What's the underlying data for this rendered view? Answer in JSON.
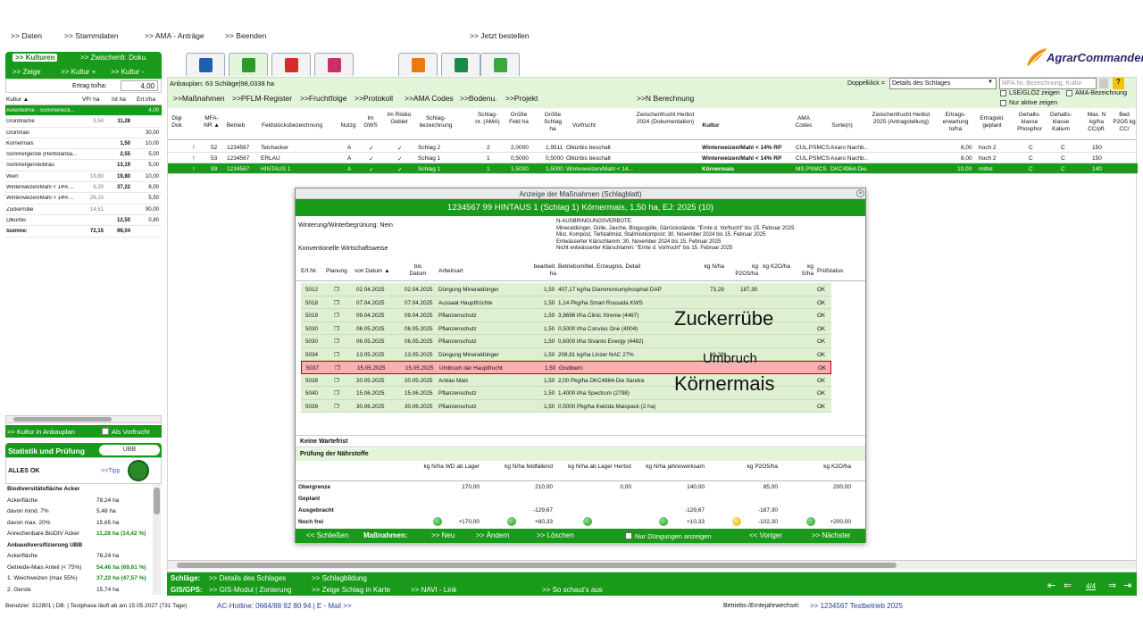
{
  "topmenu": {
    "daten": ">> Daten",
    "stammdaten": ">> Stammdaten",
    "ama": ">> AMA - Anträge",
    "beenden": ">> Beenden",
    "bestellen": ">> Jetzt bestellen"
  },
  "logo": {
    "text": "AgrarCommander"
  },
  "left": {
    "tab1": ">> Kulturen",
    "tab2": ">> Zwischenfr. Doku.",
    "zeige": ">> Zeige",
    "kultur_plus": ">> Kultur +",
    "kultur_minus": ">> Kultur -",
    "ertrag_label": "Ertrag to/ha:",
    "ertrag_value": "4,00",
    "cols": [
      "Kultur ▲",
      "VFr ha",
      "Ist ha",
      "Ert.t/ha"
    ],
    "rows": [
      [
        "Ackerbohne - Sommerwick...",
        "",
        "",
        "4,00"
      ],
      [
        "Grünbrache",
        "5,54",
        "11,28",
        ""
      ],
      [
        "Grünmais",
        "",
        "",
        "30,00"
      ],
      [
        "Körnermais",
        "",
        "1,50",
        "10,00"
      ],
      [
        "Sommergerste (Herbstanba...",
        "",
        "2,55",
        "5,00"
      ],
      [
        "Sommergerste/Brau",
        "",
        "13,19",
        "5,00"
      ],
      [
        "Wein",
        "19,80",
        "19,80",
        "10,00"
      ],
      [
        "Winterweizen/Mahl < 14% ...",
        "6,20",
        "37,22",
        "8,00"
      ],
      [
        "Winterweizen/Mahl > 14% ...",
        "26,10",
        "",
        "5,50"
      ],
      [
        "Zuckerrübe",
        "14,51",
        "",
        "90,00"
      ],
      [
        "Ölkürbis",
        "",
        "12,50",
        "0,80"
      ],
      [
        "Summe:",
        "72,15",
        "98,04",
        ""
      ]
    ],
    "kultur_anbauplan": ">> Kultur in Anbauplan",
    "als_vorfrucht": "Als Vorfrucht",
    "stat_title": "Statistik und Prüfung",
    "ubb": "UBB",
    "alles_ok": "ALLES OK",
    "tipp": ">>Tipp",
    "stat": [
      [
        "Biodiversitätsfläche Acker",
        ""
      ],
      [
        "Ackerfläche",
        "78,24 ha"
      ],
      [
        "davon mind. 7%",
        "5,48 ha"
      ],
      [
        "davon max. 20%",
        "15,65 ha"
      ],
      [
        "Anrechenbare BioDIV Acker",
        "11,28 ha (14,42 %)"
      ],
      [
        "Anbaudiversifizierung UBB",
        ""
      ],
      [
        "Ackerfläche",
        "78,24 ha"
      ],
      [
        "Getreide-Mais Anteil (< 75%)",
        "54,46 ha (69,61 %)"
      ],
      [
        "1. Weichweizen (max 55%)",
        "37,22 ha (47,57 %)"
      ],
      [
        "2. Gerste",
        "15,74 ha"
      ]
    ]
  },
  "main": {
    "anbauplan": "Anbauplan: 63 Schläge|98,0338 ha",
    "doppelklick": "Doppelklick =",
    "select_value": "Details des Schlages",
    "search_placeholder": "MFA.Nr, Bezeichnung, Kultur",
    "lse": "LSE/GLÖZ zeigen",
    "ama_bez": "AMA-Bezeichnung",
    "nur_aktive": "Nur aktive zeigen",
    "links": [
      ">>Maßnahmen",
      ">>PFLM-Register",
      ">>Fruchtfolge",
      ">>Protokoll",
      ">>AMA Codes",
      ">>Bodenu.",
      ">>Projekt",
      ">>N Berechnung"
    ],
    "headers": [
      "Digi Dok",
      "MFA-NR ▲",
      "Betrieb",
      "Feldstücksbezeichnung",
      "Nutzg",
      "Im GWS",
      "Im Risiko Gebiet",
      "Schlag-bezeichnung",
      "Schlag-nr. (AMA)",
      "Größe Feld ha",
      "Größe Schlag ha",
      "Vorfrucht",
      "Zwischenfrucht Herbst 2024 (Dokumentation)",
      "Kultur",
      "AMA Codes",
      "Sorte(n)",
      "Zwischenfrucht Herbst 2025 (Antragstellung)",
      "Ertrags-erwartung to/ha",
      "Ertragskl. geplant",
      "Gehalts-klasse Phosphor",
      "Gehalts-klasse Kalium",
      "Max. N kg/ha CC/pfl.",
      "Bed P2O5 kg CC/"
    ],
    "rows": [
      [
        "!",
        "52",
        "1234567",
        "Teichacker",
        "A",
        "✓",
        "✓",
        "Schlag 2",
        "2",
        "2,0000",
        "1,9511",
        "Ölkürbis beschalt",
        "",
        "Winterweizen/Mahl < 14% RP",
        "CUL,PSMCS",
        "Axaro Nachb...",
        "",
        "8,00",
        "hoch 2",
        "C",
        "C",
        "150"
      ],
      [
        "!",
        "53",
        "1234567",
        "ERLAU",
        "A",
        "✓",
        "✓",
        "Schlag 1",
        "1",
        "0,5000",
        "0,5000",
        "Ölkürbis beschalt",
        "",
        "Winterweizen/Mahl < 14% RP",
        "CUL,PSMCS",
        "Axaro Nachb...",
        "",
        "8,00",
        "hoch 2",
        "C",
        "C",
        "150"
      ],
      [
        "!",
        "99",
        "1234567",
        "HINTAUS 1",
        "A",
        "✓",
        "✓",
        "Schlag 1",
        "1",
        "1,5000",
        "1,5000",
        "Winterweizen/Mahl < 14...",
        "",
        "Körnermais",
        "MS,PSMCS",
        "DKC4964-Die...",
        "",
        "10,00",
        "mittel",
        "C",
        "C",
        "140"
      ]
    ]
  },
  "dialog": {
    "title": "Anzeige der Maßnahmen (Schlagblatt)",
    "subtitle": "1234567 99 HINTAUS 1 (Schlag 1) Körnermais, 1,50 ha, EJ: 2025 (10)",
    "winterung": "Winterung/Winterbegrünung: Nein",
    "wirtschaft": "Konventionelle Wirtschaftsweise",
    "verbote": [
      "N-AUSBRINGUNGSVERBOTE:",
      "Mineraldünger, Gülle, Jauche, Biogasgülle, Gärrückstände: \"Ernte d. Vorfrucht\" bis 15. Februar 2025",
      "Mist, Kompost, Tiefstallmist, Stallmistkompost: 30. November 2024 bis 15. Februar 2025",
      "Entwässerter Klärschlamm: 30. November 2024 bis 15. Februar 2025",
      "Nicht entwässerter Klärschlamm: \"Ernte d. Vorfrucht\" bis 15. Februar 2025"
    ],
    "cols": [
      "Erf.Nr.",
      "Planung",
      "von Datum ▲",
      "bis Datum",
      "Arbeitsart",
      "bearbeit. ha",
      "Betriebsmittel, Erzeugnis, Detail",
      "kg N/ha",
      "kg P2O5/ha",
      "kg K2O/ha",
      "kg S/ha",
      "Prüfstatus"
    ],
    "rows": [
      [
        "5012",
        "❐",
        "02.04.2025",
        "02.04.2025",
        "Düngung Mineraldünger",
        "1,50",
        "407,17 kg/ha Diammoniumphosphat DAP",
        "73,29",
        "187,30",
        "",
        "",
        "OK"
      ],
      [
        "5018",
        "❐",
        "07.04.2025",
        "07.04.2025",
        "Aussaat Hauptfrüchte",
        "1,50",
        "1,14 Pkg/ha Smart Rossada KWS",
        "",
        "",
        "",
        "",
        "OK"
      ],
      [
        "5019",
        "❐",
        "09.04.2025",
        "09.04.2025",
        "Pflanzenschutz",
        "1,50",
        "3,9696 l/ha Clinic Xtreme (4467)",
        "",
        "",
        "",
        "",
        "OK"
      ],
      [
        "5030",
        "❐",
        "06.05.2025",
        "06.05.2025",
        "Pflanzenschutz",
        "1,50",
        "0,5000 l/ha Conviso One (4004)",
        "",
        "",
        "",
        "",
        "OK"
      ],
      [
        "5030",
        "❐",
        "06.05.2025",
        "06.05.2025",
        "Pflanzenschutz",
        "1,50",
        "0,6000 l/ha Sivanto Energy (4482)",
        "",
        "",
        "",
        "",
        "OK"
      ],
      [
        "5034",
        "❐",
        "13.05.2025",
        "13.05.2025",
        "Düngung Mineraldünger",
        "1,50",
        "208,81 kg/ha Linzer NAC 27%",
        "56,38",
        "",
        "",
        "",
        "OK"
      ],
      [
        "5037",
        "❐",
        "15.05.2025",
        "15.05.2025",
        "Umbruch der Hauptfrucht",
        "1,50",
        "Grubbern",
        "",
        "",
        "",
        "",
        "OK"
      ],
      [
        "5038",
        "❐",
        "20.05.2025",
        "20.05.2025",
        "Anbau Mais",
        "1,50",
        "2,00 Pkg/ha DKC4964-Die Sandra",
        "",
        "",
        "",
        "",
        "OK"
      ],
      [
        "5040",
        "❐",
        "15.06.2025",
        "15.06.2025",
        "Pflanzenschutz",
        "1,50",
        "1,4000 l/ha Spectrum (2798)",
        "",
        "",
        "",
        "",
        "OK"
      ],
      [
        "5039",
        "❐",
        "30.06.2025",
        "30.06.2025",
        "Pflanzenschutz",
        "1,50",
        "0,5000 Pkg/ha Kwizda Maispack (2 ha)",
        "",
        "",
        "",
        "",
        "OK"
      ]
    ],
    "overlay_zucker": "Zuckerrübe",
    "overlay_umbruch": "Umbruch",
    "overlay_koerner": "Körnermais",
    "keine_wartefrist": "Keine Wartefrist",
    "pruefung": "Prüfung der Nährstoffe",
    "nut_cols": [
      "kg N/ha WD ab Lager",
      "kg N/ha feldfallend",
      "kg N/ha ab Lager Herbst",
      "kg N/ha jahreswirksam",
      "kg P2O5/ha",
      "kg K2O/ha"
    ],
    "nut_rows": [
      [
        "Obergrenze",
        "170,00",
        "210,00",
        "0,00",
        "140,00",
        "85,00",
        "200,00"
      ],
      [
        "Geplant",
        "",
        "",
        "",
        "",
        "",
        ""
      ],
      [
        "Ausgebracht",
        "",
        "-129,67",
        "",
        "-129,67",
        "-187,30",
        ""
      ],
      [
        "Noch frei",
        "+170,00",
        "+80,33",
        "",
        "+10,33",
        "-102,30",
        "+200,00"
      ]
    ],
    "footer": {
      "schliessen": "<< Schließen",
      "massnahmen": "Maßnahmen:",
      "neu": ">> Neu",
      "aendern": ">> Ändern",
      "loeschen": ">> Löschen",
      "nur_duengungen": "Nur Düngungen anzeigen",
      "voriger": "<< Voriger",
      "naechster": ">> Nächster"
    }
  },
  "bottom": {
    "schlaege": "Schläge:",
    "details": ">> Details des Schlages",
    "schlagbildung": ">> Schlagbildung",
    "gis": "GIS/GPS:",
    "gis_modul": ">> GIS-Modul | Zonierung",
    "zeige_karte": ">> Zeige Schlag in Karte",
    "navi": ">> NAVI - Link",
    "so_schauts": ">> So schaut's aus",
    "page": "4/4"
  },
  "status": {
    "benutzer": "Benutzer: 312801 | DB: | Testphase läuft ab am 15.05.2027 (731 Tage)",
    "hotline": "AC-Hotline: 0664/88 92 80 94 | E - Mail >>",
    "wechsel": "Betriebs-/Erntejahrwechsel:",
    "betrieb": ">> 1234567 Testbetrieb 2025"
  }
}
